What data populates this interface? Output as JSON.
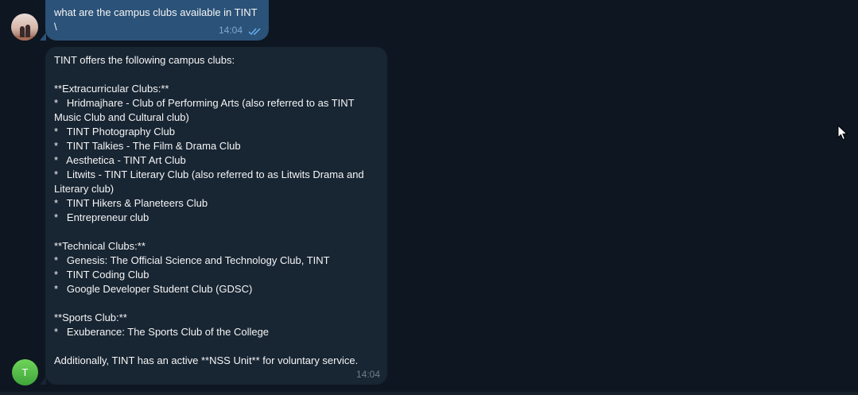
{
  "messages": {
    "outgoing": {
      "lines": [
        "what are the campus clubs available in TINT",
        "\\"
      ],
      "time": "14:04",
      "status_icon": "double-check-icon"
    },
    "incoming": {
      "lines": [
        "TINT offers the following campus clubs:",
        "",
        "**Extracurricular Clubs:**",
        "*   Hridmajhare - Club of Performing Arts (also referred to as TINT",
        "Music Club and Cultural club)",
        "*   TINT Photography Club",
        "*   TINT Talkies - The Film & Drama Club",
        "*   Aesthetica - TINT Art Club",
        "*   Litwits - TINT Literary Club (also referred to as Litwits Drama and",
        "Literary club)",
        "*   TINT Hikers & Planeteers Club",
        "*   Entrepreneur club",
        "",
        "**Technical Clubs:**",
        "*   Genesis: The Official Science and Technology Club, TINT",
        "*   TINT Coding Club",
        "*   Google Developer Student Club (GDSC)",
        "",
        "**Sports Club:**",
        "*   Exuberance: The Sports Club of the College",
        "",
        "Additionally, TINT has an active **NSS Unit** for voluntary service."
      ],
      "time": "14:04"
    }
  },
  "bot_avatar": {
    "initial": "T"
  },
  "colors": {
    "background": "#0e1621",
    "outgoing_bubble": "#2b5278",
    "incoming_bubble": "#182533",
    "bot_avatar": "#4fb845"
  }
}
